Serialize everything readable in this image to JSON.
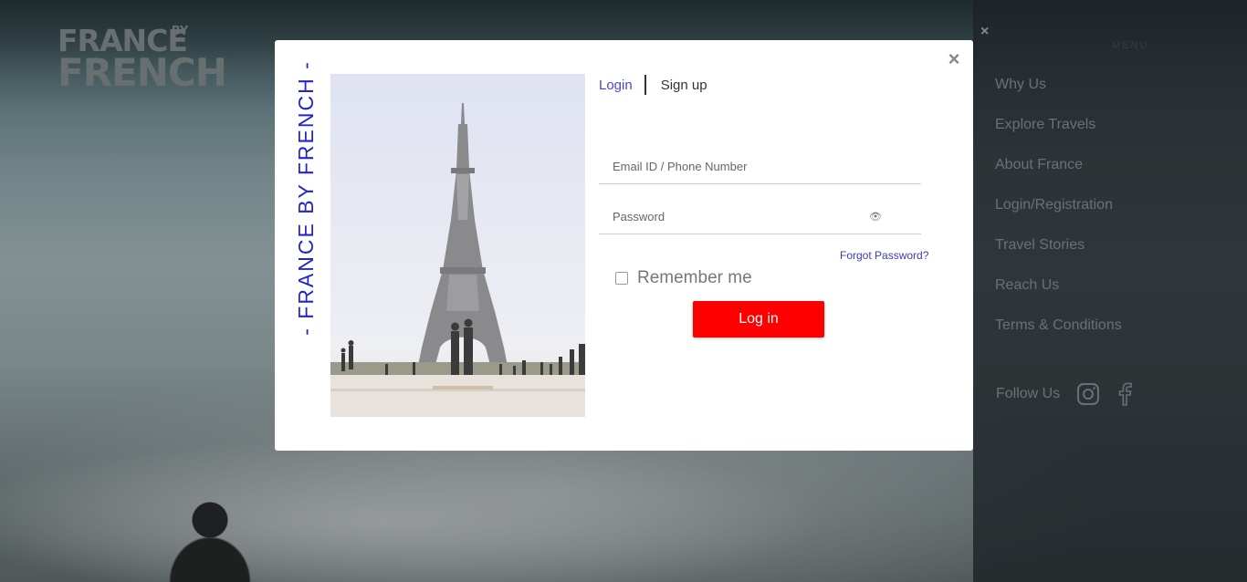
{
  "logo": {
    "line1": "FRANCE",
    "by": "BY",
    "line2": "FRENCH"
  },
  "side_menu": {
    "close_glyph": "×",
    "header": "MENU",
    "items": [
      {
        "label": "Why Us"
      },
      {
        "label": "Explore Travels"
      },
      {
        "label": "About France"
      },
      {
        "label": "Login/Registration"
      },
      {
        "label": "Travel Stories"
      },
      {
        "label": "Reach Us"
      },
      {
        "label": "Terms & Conditions"
      }
    ],
    "follow_label": "Follow Us",
    "social_icons": [
      "instagram-icon",
      "facebook-icon"
    ]
  },
  "modal": {
    "close_glyph": "×",
    "vertical_brand": "- FRANCE BY FRENCH -",
    "photo_subject": "eiffel-tower",
    "tabs": {
      "login": "Login",
      "signup": "Sign up"
    },
    "email": {
      "placeholder": "Email ID / Phone Number",
      "value": ""
    },
    "password": {
      "placeholder": "Password",
      "value": "",
      "toggle_icon": "eye-icon"
    },
    "forgot_password": "Forgot Password?",
    "remember_me": {
      "label": "Remember me",
      "checked": false
    },
    "login_button": "Log in",
    "colors": {
      "accent": "#2424c8",
      "button": "#ff0000",
      "link": "#3c3cb8"
    }
  }
}
